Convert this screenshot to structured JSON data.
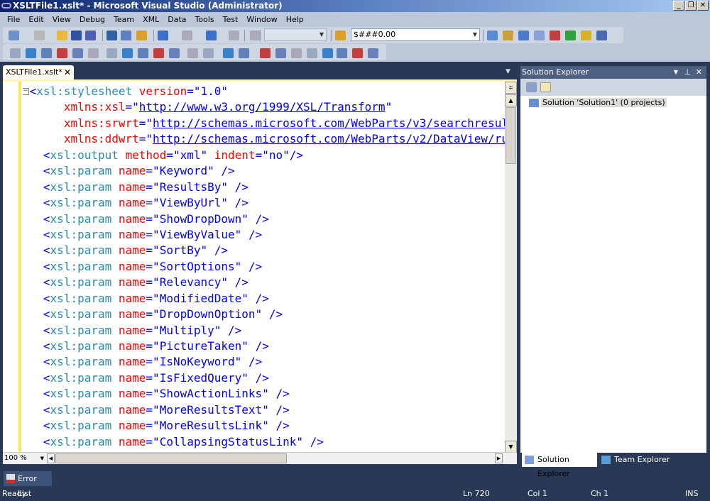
{
  "window": {
    "title": "XSLTFile1.xslt* - Microsoft Visual Studio (Administrator)",
    "controls": [
      "minimize",
      "restore",
      "close"
    ]
  },
  "menu": [
    "File",
    "Edit",
    "View",
    "Debug",
    "Team",
    "XML",
    "Data",
    "Tools",
    "Test",
    "Window",
    "Help"
  ],
  "toolbar": {
    "solution_config": "",
    "format_combo": "$###0.00"
  },
  "document_tab": {
    "label": "XSLTFile1.xslt*"
  },
  "editor": {
    "lines": [
      [
        [
          "b",
          "<"
        ],
        [
          "e",
          "xsl:stylesheet"
        ],
        [
          "t",
          " "
        ],
        [
          "a",
          "version"
        ],
        [
          "b",
          "=\""
        ],
        [
          "v",
          "1.0"
        ],
        [
          "b",
          "\""
        ]
      ],
      [
        [
          "t",
          "     "
        ],
        [
          "a",
          "xmlns:xsl"
        ],
        [
          "b",
          "=\""
        ],
        [
          "u",
          "http://www.w3.org/1999/XSL/Transform"
        ],
        [
          "b",
          "\""
        ]
      ],
      [
        [
          "t",
          "     "
        ],
        [
          "a",
          "xmlns:srwrt"
        ],
        [
          "b",
          "=\""
        ],
        [
          "u",
          "http://schemas.microsoft.com/WebParts/v3/searchresul"
        ]
      ],
      [
        [
          "t",
          "     "
        ],
        [
          "a",
          "xmlns:ddwrt"
        ],
        [
          "b",
          "=\""
        ],
        [
          "u",
          "http://schemas.microsoft.com/WebParts/v2/DataView/ru"
        ]
      ],
      [
        [
          "t",
          "  "
        ],
        [
          "b",
          "<"
        ],
        [
          "e",
          "xsl:output"
        ],
        [
          "t",
          " "
        ],
        [
          "a",
          "method"
        ],
        [
          "b",
          "=\""
        ],
        [
          "v",
          "xml"
        ],
        [
          "b",
          "\""
        ],
        [
          "t",
          " "
        ],
        [
          "a",
          "indent"
        ],
        [
          "b",
          "=\""
        ],
        [
          "v",
          "no"
        ],
        [
          "b",
          "\"/>"
        ]
      ],
      [
        [
          "p",
          "Keyword"
        ]
      ],
      [
        [
          "p",
          "ResultsBy"
        ]
      ],
      [
        [
          "p",
          "ViewByUrl"
        ]
      ],
      [
        [
          "p",
          "ShowDropDown"
        ]
      ],
      [
        [
          "p",
          "ViewByValue"
        ]
      ],
      [
        [
          "p",
          "SortBy"
        ]
      ],
      [
        [
          "p",
          "SortOptions"
        ]
      ],
      [
        [
          "p",
          "Relevancy"
        ]
      ],
      [
        [
          "p",
          "ModifiedDate"
        ]
      ],
      [
        [
          "p",
          "DropDownOption"
        ]
      ],
      [
        [
          "p",
          "Multiply"
        ]
      ],
      [
        [
          "p",
          "PictureTaken"
        ]
      ],
      [
        [
          "p",
          "IsNoKeyword"
        ]
      ],
      [
        [
          "p",
          "IsFixedQuery"
        ]
      ],
      [
        [
          "p",
          "ShowActionLinks"
        ]
      ],
      [
        [
          "p",
          "MoreResultsText"
        ]
      ],
      [
        [
          "p",
          "MoreResultsLink"
        ]
      ],
      [
        [
          "p",
          "CollapsingStatusLink"
        ]
      ]
    ],
    "zoom_level": "100 %"
  },
  "colors": {
    "bracket": "#0000ff",
    "element": "#2b8cac",
    "attribute": "#ff0000",
    "value": "#0000ff",
    "chrome": "#293955"
  },
  "solution_explorer": {
    "title": "Solution Explorer",
    "item": "Solution 'Solution1' (0 projects)",
    "tabs": [
      "Solution Explorer",
      "Team Explorer"
    ]
  },
  "error_list": {
    "label": "Error List"
  },
  "status": {
    "text": "Ready",
    "line": "Ln 720",
    "col": "Col 1",
    "ch": "Ch 1",
    "mode": "INS"
  }
}
